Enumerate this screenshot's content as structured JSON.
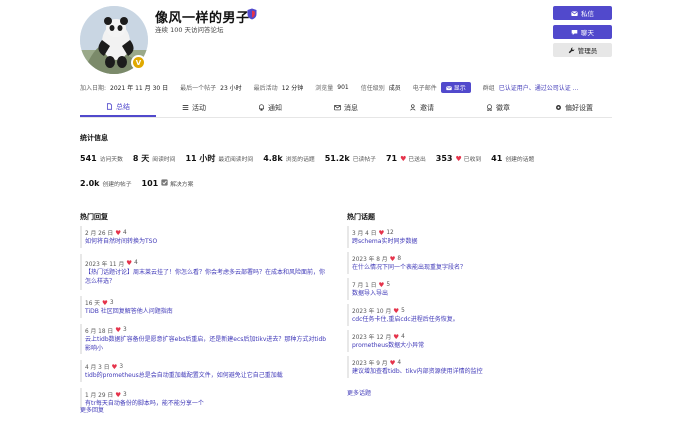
{
  "profile": {
    "username": "像风一样的男子",
    "subtitle": "连续 100 天访问答论坛",
    "avatar_badge": "V"
  },
  "actions": {
    "message": "私信",
    "chat": "聊天",
    "admin": "管理员"
  },
  "meta": {
    "joined_label": "加入日期:",
    "joined_value": "2021 年 11 月 30 日",
    "last_post_label": "最后一个帖子",
    "last_post_value": "23 小时",
    "last_active_label": "最后活动",
    "last_active_value": "12 分钟",
    "views_label": "浏览量",
    "views_value": "901",
    "trust_label": "信任级别",
    "trust_value": "成员",
    "email_label": "电子邮件",
    "show_label": "显示",
    "groups_label": "群组",
    "groups_value": "已认证用户、通过公司认证 ..."
  },
  "tabs": [
    {
      "label": "总结",
      "icon": "summary-icon"
    },
    {
      "label": "活动",
      "icon": "activity-icon"
    },
    {
      "label": "通知",
      "icon": "bell-icon"
    },
    {
      "label": "消息",
      "icon": "envelope-icon"
    },
    {
      "label": "邀请",
      "icon": "user-plus-icon"
    },
    {
      "label": "徽章",
      "icon": "badge-icon"
    },
    {
      "label": "偏好设置",
      "icon": "gear-icon"
    }
  ],
  "stats": {
    "title": "统计信息",
    "row1": [
      {
        "num": "541",
        "label": "访问天数"
      },
      {
        "num": "8 天",
        "label": "阅读时间"
      },
      {
        "num": "11 小时",
        "label": "最近阅读时间"
      },
      {
        "num": "4.8k",
        "label": "浏览的话题"
      },
      {
        "num": "51.2k",
        "label": "已读帖子"
      },
      {
        "num": "71",
        "label": "已送出"
      },
      {
        "num": "353",
        "label": "已收到"
      },
      {
        "num": "41",
        "label": "创建的话题"
      }
    ],
    "row2": [
      {
        "num": "2.0k",
        "label": "创建的帖子"
      },
      {
        "num": "101",
        "label": "解决方案"
      }
    ]
  },
  "hot_replies": {
    "title": "热门回复",
    "more": "更多回复",
    "items": [
      {
        "date": "2 月 26 日",
        "likes": "4",
        "title": "如何将自然时间转换为TSO"
      },
      {
        "date": "2023 年 11 月",
        "likes": "4",
        "title": "【热门话题讨论】周末莱云挂了！你怎么看？你会考虑多云部署吗？在成本和风险面前，你怎么样选？"
      },
      {
        "date": "16 天",
        "likes": "3",
        "title": "TiDB 社区回复解答他人问题指南"
      },
      {
        "date": "6 月 18 日",
        "likes": "3",
        "title": "云上tidb数据扩容备份是愿意扩容ebs后重启，还是新建ecs后加tikv进去？那种方式对tidb影响小"
      },
      {
        "date": "4 月 3 日",
        "likes": "3",
        "title": "tidb的prometheus总是会自动重加载配置文件，如何避免让它自己重加载"
      },
      {
        "date": "1 月 29 日",
        "likes": "3",
        "title": "有tr每天自动备份的脚本吗，能不能分享一个"
      }
    ]
  },
  "hot_topics": {
    "title": "热门话题",
    "more": "更多话题",
    "items": [
      {
        "date": "3 月 4 日",
        "likes": "12",
        "title": "跨schema实时同步数据"
      },
      {
        "date": "2023 年 8 月",
        "likes": "8",
        "title": "在什么情况下同一个表能出现重复字段名？"
      },
      {
        "date": "7 月 1 日",
        "likes": "5",
        "title": "数据导入导出"
      },
      {
        "date": "2023 年 10 月",
        "likes": "5",
        "title": "cdc任务卡住,重启cdc进程后任务恢复。"
      },
      {
        "date": "2023 年 12 月",
        "likes": "4",
        "title": "prometheus数据大小异常"
      },
      {
        "date": "2023 年 9 月",
        "likes": "4",
        "title": "建议增加查看tidb、tikv内部资源使用详情的监控"
      }
    ]
  }
}
